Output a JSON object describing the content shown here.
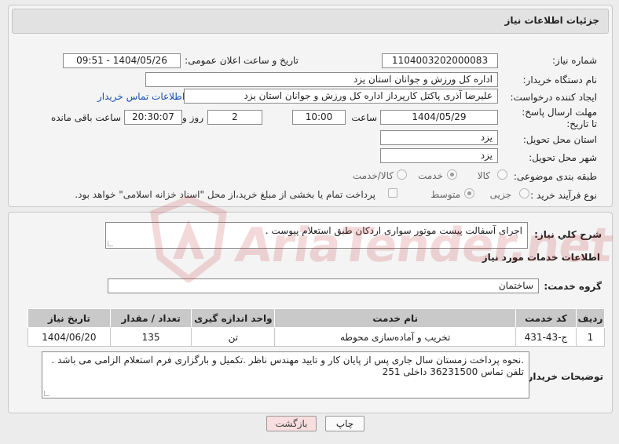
{
  "page_title": "جزئیات اطلاعات نیاز",
  "need_number": {
    "label": "شماره نیاز:",
    "value": "1104003202000083"
  },
  "announce_datetime": {
    "label": "تاریخ و ساعت اعلان عمومی:",
    "value": "1404/05/26 - 09:51"
  },
  "buyer_org": {
    "label": "نام دستگاه خریدار:",
    "value": "اداره کل ورزش و جوانان استان یزد"
  },
  "requester": {
    "label": "ایجاد کننده درخواست:",
    "value": "علیرضا آذری پاکتل کارپرداز اداره کل ورزش و جوانان استان یزد",
    "contact_link": "اطلاعات تماس خریدار"
  },
  "deadline": {
    "label": "مهلت ارسال پاسخ: تا تاریخ:",
    "date": "1404/05/29",
    "time_label": "ساعت",
    "time": "10:00",
    "days": "2",
    "days_label": "روز و",
    "remaining": "20:30:07",
    "remaining_label": "ساعت باقی مانده"
  },
  "delivery_province": {
    "label": "استان محل تحویل:",
    "value": "یزد"
  },
  "delivery_city": {
    "label": "شهر محل تحویل:",
    "value": "یزد"
  },
  "category": {
    "label": "طبقه بندی موضوعی:",
    "options": [
      "کالا",
      "خدمت",
      "کالا/خدمت"
    ],
    "selected": "خدمت"
  },
  "process_type": {
    "label": "نوع فرآیند خرید :",
    "options": [
      "جزیی",
      "متوسط"
    ],
    "selected": "متوسط",
    "payment_note": "پرداخت تمام یا بخشی از مبلغ خرید،از محل \"اسناد خزانه اسلامی\" خواهد بود."
  },
  "general_desc": {
    "label": "شرح کلي نياز:",
    "value": "اجرای آسفالت پیست موتور سواری اردکان طبق استعلام پیوست ."
  },
  "services_title": "اطلاعات خدمات مورد نیاز",
  "service_group": {
    "label": "گروه خدمت:",
    "value": "ساختمان"
  },
  "table": {
    "headers": [
      "ردیف",
      "کد خدمت",
      "نام خدمت",
      "واحد اندازه گیری",
      "تعداد / مقدار",
      "تاریخ نیاز"
    ],
    "rows": [
      [
        "1",
        "ج-43-431",
        "تخریب و آماده‌سازی محوطه",
        "تن",
        "135",
        "1404/06/20"
      ]
    ]
  },
  "buyer_notes": {
    "label": "توضیحات خریدار:",
    "line1": ".نحوه پرداخت زمستان سال جاری پس از پایان کار و تایید مهندس ناظر .تکمیل و بارگزاری فرم استعلام  الزامی می باشد .",
    "line2": "تلفن تماس 36231500 داخلی 251"
  },
  "buttons": {
    "print": "چاپ",
    "back": "بازگشت"
  },
  "watermark": "AriaTender.net",
  "colors": {
    "link": "#1a4fb5",
    "watermark": "#c21d25",
    "back_button": "#f8dede",
    "print_button": "#fafafa"
  }
}
